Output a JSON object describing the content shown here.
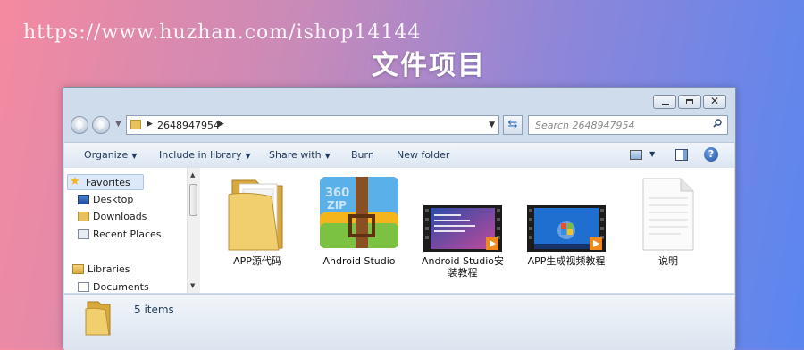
{
  "watermark": "https://www.huzhan.com/ishop14144",
  "heading": "文件项目",
  "window": {
    "breadcrumb": "2648947954",
    "search_placeholder": "Search 2648947954",
    "caption_close": "✕"
  },
  "toolbar": {
    "organize": "Organize",
    "include_in_library": "Include in library",
    "share_with": "Share with",
    "burn": "Burn",
    "new_folder": "New folder",
    "help": "?"
  },
  "nav": {
    "favorites": "Favorites",
    "desktop": "Desktop",
    "downloads": "Downloads",
    "recent_places": "Recent Places",
    "libraries": "Libraries",
    "documents": "Documents"
  },
  "files": [
    {
      "name": "APP源代码",
      "icon": "folder-icon"
    },
    {
      "name": "Android Studio",
      "icon": "archive-icon",
      "archive_text": "360\nZIP"
    },
    {
      "name": "Android Studio安装教程",
      "icon": "video-thumbnail-icon"
    },
    {
      "name": "APP生成视频教程",
      "icon": "video-thumbnail-icon"
    },
    {
      "name": "说明",
      "icon": "text-document-icon"
    }
  ],
  "status": {
    "item_count": "5 items"
  },
  "colors": {
    "accent": "#1e395b",
    "folder": "#e7c15a",
    "selection": "#dce9f8"
  }
}
